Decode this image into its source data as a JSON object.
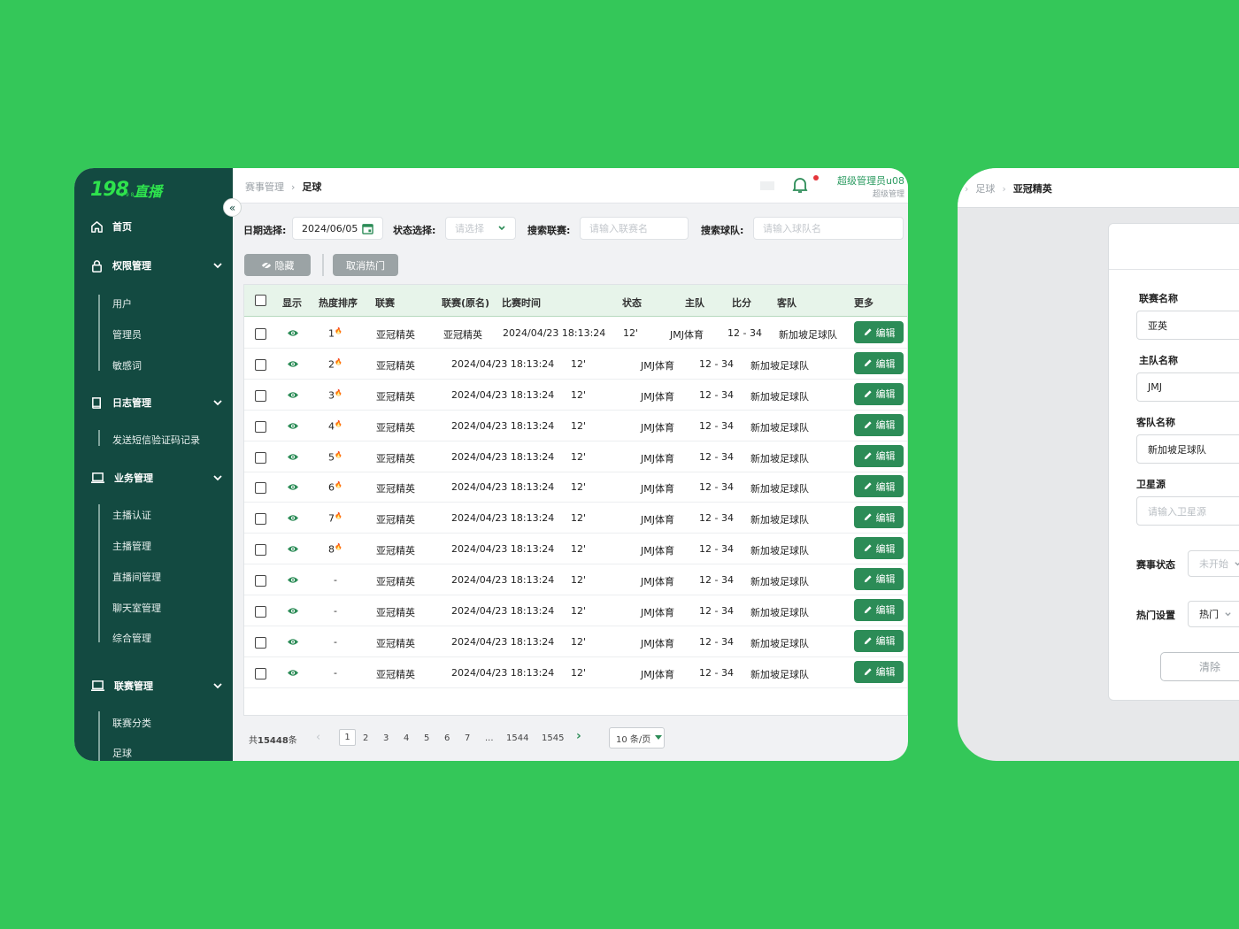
{
  "brand": {
    "logo_mark": "198",
    "logo_text": "直播",
    "logo_sub": "198.TT"
  },
  "sidebar": {
    "groups": [
      {
        "label": "首页",
        "icon": "home-icon"
      },
      {
        "label": "权限管理",
        "icon": "lock-icon",
        "items": [
          "用户",
          "管理员",
          "敏感词"
        ]
      },
      {
        "label": "日志管理",
        "icon": "book-icon",
        "items": [
          "发送短信验证码记录"
        ]
      },
      {
        "label": "业务管理",
        "icon": "laptop-icon",
        "items": [
          "主播认证",
          "主播管理",
          "直播间管理",
          "聊天室管理",
          "综合管理"
        ]
      },
      {
        "label": "联赛管理",
        "icon": "laptop-icon",
        "items": [
          "联赛分类",
          "足球"
        ]
      }
    ],
    "collapse_glyph": "«"
  },
  "header": {
    "breadcrumb": [
      "赛事管理",
      "足球"
    ],
    "user_name": "超级管理员u08",
    "user_role": "超级管理"
  },
  "filters": {
    "date_label": "日期选择:",
    "date_value": "2024/06/05",
    "status_label": "状态选择:",
    "status_placeholder": "请选择",
    "league_label": "搜索联赛:",
    "league_placeholder": "请输入联赛名",
    "team_label": "搜索球队:",
    "team_placeholder": "请输入球队名"
  },
  "actions": {
    "hide": "隐藏",
    "cancel_hot": "取消热门"
  },
  "table": {
    "columns": [
      "显示",
      "热度排序",
      "联赛",
      "联赛(原名)",
      "比赛时间",
      "状态",
      "主队",
      "比分",
      "客队",
      "更多"
    ],
    "edit_label": "编辑",
    "first_row": {
      "rank": "1",
      "league": "亚冠精英",
      "league_orig": "亚冠精英",
      "time": "2024/04/23 18:13:24",
      "status": "12'",
      "home": "JMJ体育",
      "score": "12 - 34",
      "away": "新加坡足球队"
    },
    "rows": [
      {
        "rank": "2",
        "league": "亚冠精英",
        "time": "2024/04/23 18:13:24",
        "status": "12'",
        "home": "JMJ体育",
        "score": "12 - 34",
        "away": "新加坡足球队"
      },
      {
        "rank": "3",
        "league": "亚冠精英",
        "time": "2024/04/23 18:13:24",
        "status": "12'",
        "home": "JMJ体育",
        "score": "12 - 34",
        "away": "新加坡足球队"
      },
      {
        "rank": "4",
        "league": "亚冠精英",
        "time": "2024/04/23 18:13:24",
        "status": "12'",
        "home": "JMJ体育",
        "score": "12 - 34",
        "away": "新加坡足球队"
      },
      {
        "rank": "5",
        "league": "亚冠精英",
        "time": "2024/04/23 18:13:24",
        "status": "12'",
        "home": "JMJ体育",
        "score": "12 - 34",
        "away": "新加坡足球队"
      },
      {
        "rank": "6",
        "league": "亚冠精英",
        "time": "2024/04/23 18:13:24",
        "status": "12'",
        "home": "JMJ体育",
        "score": "12 - 34",
        "away": "新加坡足球队"
      },
      {
        "rank": "7",
        "league": "亚冠精英",
        "time": "2024/04/23 18:13:24",
        "status": "12'",
        "home": "JMJ体育",
        "score": "12 - 34",
        "away": "新加坡足球队"
      },
      {
        "rank": "8",
        "league": "亚冠精英",
        "time": "2024/04/23 18:13:24",
        "status": "12'",
        "home": "JMJ体育",
        "score": "12 - 34",
        "away": "新加坡足球队"
      },
      {
        "rank": "-",
        "league": "亚冠精英",
        "time": "2024/04/23 18:13:24",
        "status": "12'",
        "home": "JMJ体育",
        "score": "12 - 34",
        "away": "新加坡足球队"
      },
      {
        "rank": "-",
        "league": "亚冠精英",
        "time": "2024/04/23 18:13:24",
        "status": "12'",
        "home": "JMJ体育",
        "score": "12 - 34",
        "away": "新加坡足球队"
      },
      {
        "rank": "-",
        "league": "亚冠精英",
        "time": "2024/04/23 18:13:24",
        "status": "12'",
        "home": "JMJ体育",
        "score": "12 - 34",
        "away": "新加坡足球队"
      },
      {
        "rank": "-",
        "league": "亚冠精英",
        "time": "2024/04/23 18:13:24",
        "status": "12'",
        "home": "JMJ体育",
        "score": "12 - 34",
        "away": "新加坡足球队"
      }
    ]
  },
  "pagination": {
    "total_prefix": "共",
    "total_count": "15448",
    "total_suffix": "条",
    "pages": [
      "1",
      "2",
      "3",
      "4",
      "5",
      "6",
      "7",
      "...",
      "1544",
      "1545"
    ],
    "current": "1",
    "page_size": "10 条/页"
  },
  "detail": {
    "breadcrumb": [
      "足球",
      "亚冠精英"
    ],
    "fields": [
      {
        "label": "联赛名称",
        "value": "亚英"
      },
      {
        "label": "主队名称",
        "value": "JMJ"
      },
      {
        "label": "客队名称",
        "value": "新加坡足球队"
      },
      {
        "label": "卫星源",
        "placeholder": "请输入卫星源"
      }
    ],
    "status_label": "赛事状态",
    "status_value": "未开始",
    "hot_label": "热门设置",
    "hot_value": "热门",
    "clear_button": "清除"
  },
  "colors": {
    "background": "#34c759",
    "sidebar": "#134a41",
    "accent": "#2c8c57",
    "brand": "#2ee24d"
  }
}
